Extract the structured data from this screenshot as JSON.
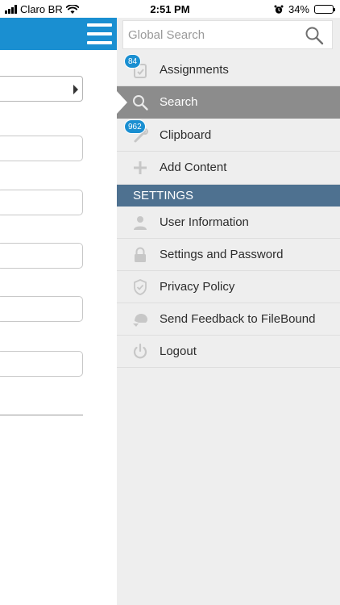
{
  "status_bar": {
    "carrier": "Claro BR",
    "time": "2:51 PM",
    "battery": "34%",
    "battery_level": 0.34
  },
  "drawer": {
    "search": {
      "placeholder": "Global Search"
    },
    "menu": [
      {
        "label": "Assignments",
        "badge": "84",
        "icon": "assignments-icon"
      },
      {
        "label": "Search",
        "icon": "search-icon",
        "active": true
      },
      {
        "label": "Clipboard",
        "badge": "962",
        "icon": "clipboard-icon"
      },
      {
        "label": "Add Content",
        "icon": "plus-icon"
      }
    ],
    "settings_header": "SETTINGS",
    "settings": [
      {
        "label": "User Information",
        "icon": "user-icon"
      },
      {
        "label": "Settings and Password",
        "icon": "lock-icon"
      },
      {
        "label": "Privacy Policy",
        "icon": "shield-icon"
      },
      {
        "label": "Send Feedback to FileBound",
        "icon": "feedback-icon"
      },
      {
        "label": "Logout",
        "icon": "power-icon"
      }
    ]
  },
  "colors": {
    "header_blue": "#1a8fd1",
    "settings_bar": "#4e7190",
    "active_row": "#8c8c8c",
    "drawer_bg": "#eeeeee",
    "badge": "#1a8fd1"
  }
}
